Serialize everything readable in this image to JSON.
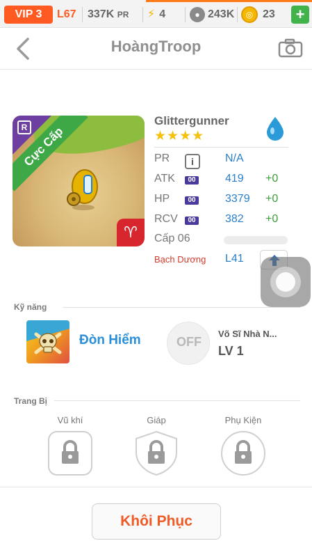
{
  "topbar": {
    "vip": "VIP 3",
    "level": "L67",
    "pr_value": "337K",
    "pr_unit": "PR",
    "energy": "4",
    "paws": "243K",
    "coins": "23",
    "plus_label": "+"
  },
  "header": {
    "title": "HoàngTroop"
  },
  "hero": {
    "ribbon": "Cực Cấp",
    "badge": "R",
    "zodiac_symbol": "♈",
    "name": "Glittergunner",
    "stars": "★★★★",
    "stats": [
      {
        "label": "PR",
        "icon": "i",
        "value": "N/A",
        "bonus": ""
      },
      {
        "label": "ATK",
        "icon": "00",
        "value": "419",
        "bonus": "+0"
      },
      {
        "label": "HP",
        "icon": "00",
        "value": "3379",
        "bonus": "+0"
      },
      {
        "label": "RCV",
        "icon": "00",
        "value": "382",
        "bonus": "+0"
      }
    ],
    "level_label": "Cấp 06",
    "level_progress": 0.0,
    "zodiac_name": "Bạch Dương",
    "zodiac_level": "L41"
  },
  "skills": {
    "section_title": "Kỹ năng",
    "active_name": "Đòn Hiểm",
    "passive_state": "OFF",
    "passive_name": "Võ Sĩ Nhà N...",
    "passive_level": "LV 1"
  },
  "equipment": {
    "section_title": "Trang Bị",
    "slots": [
      {
        "label": "Vũ khí"
      },
      {
        "label": "Giáp"
      },
      {
        "label": "Phụ Kiện"
      }
    ]
  },
  "footer": {
    "restore_label": "Khôi Phục"
  },
  "colors": {
    "accent_orange": "#ff5a22",
    "stat_blue": "#2a7fc9",
    "bonus_green": "#3c9e3c",
    "star_yellow": "#f4c20d"
  }
}
